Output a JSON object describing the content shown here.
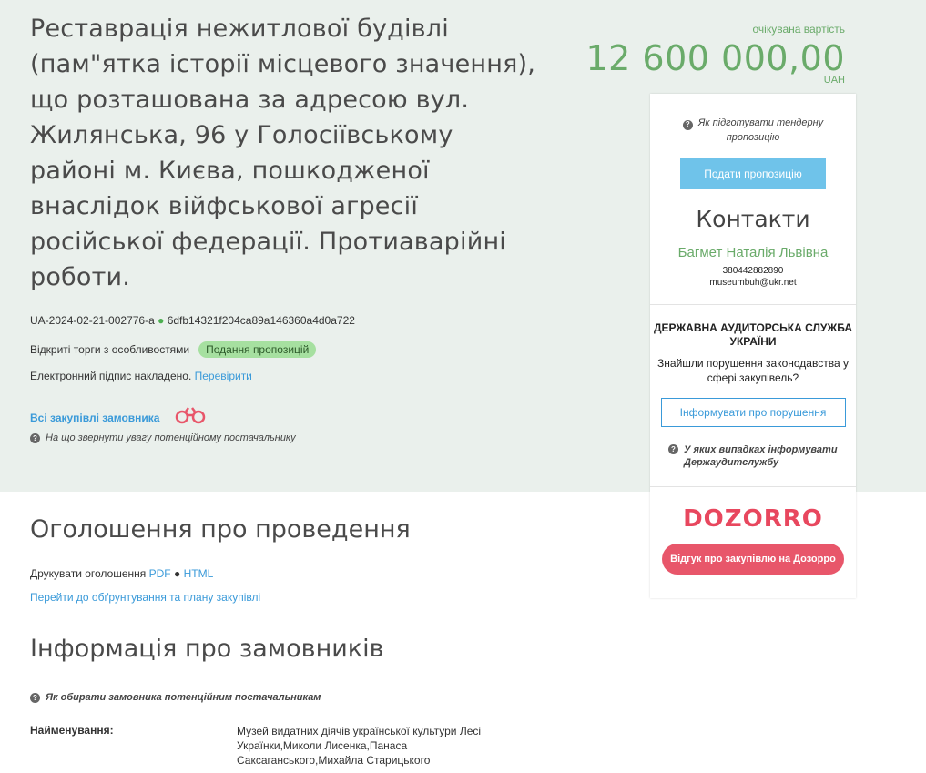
{
  "tender": {
    "title": "Реставрація нежитлової будівлі (пам\"ятка історії місцевого значення), що розташована за адресою вул. Жилянська, 96 у Голосіївському районі м. Києва, пошкодженої внаслідок війфськової агресії російської федерації. Протиаварійні роботи.",
    "id": "UA-2024-02-21-002776-a",
    "hash": "6dfb14321f204ca89a146360a4d0a722",
    "procedure_type": "Відкриті торги з особливостями",
    "status_badge": "Подання пропозицій",
    "signature_text": "Електронний підпис накладено.",
    "signature_link": "Перевірити",
    "all_purchases_link": "Всі закупівлі замовника",
    "supplier_attention": "На що звернути увагу потенційному постачальнику"
  },
  "price": {
    "label": "очікувана вартість",
    "amount": "12 600 000,00",
    "currency": "UAH"
  },
  "panel": {
    "how_to_prepare": "Як підготувати тендерну пропозицію",
    "submit_button": "Подати пропозицію",
    "contacts_title": "Контакти",
    "contact_name": "Багмет Наталія Львівна",
    "contact_phone": "380442882890",
    "contact_email": "museumbuh@ukr.net",
    "audit_title": "ДЕРЖАВНА АУДИТОРСЬКА СЛУЖБА УКРАЇНИ",
    "audit_question": "Знайшли порушення законодавства у сфері закупівель?",
    "report_button": "Інформувати про порушення",
    "audit_help": "У яких випадках інформувати Держаудитслужбу",
    "dozorro_logo": "DOZORRO",
    "dozorro_button": "Відгук про закупівлю на Дозорро"
  },
  "announcement": {
    "heading": "Оголошення про проведення",
    "print_label": "Друкувати оголошення",
    "pdf_link": "PDF",
    "html_link": "HTML",
    "plan_link": "Перейти до обґрунтування та плану закупівлі"
  },
  "customers": {
    "heading": "Інформація про замовників",
    "help": "Як обирати замовника потенційним постачальникам",
    "name_label": "Найменування:",
    "name_value": "Музей видатних діячів української культури Лесі Українки,Миколи Лисенка,Панаса Саксаганського,Михайла Старицького"
  },
  "icons": {
    "binoculars": "binoculars-icon",
    "question": "question-circle-icon"
  },
  "colors": {
    "accent_green": "#6aab6a",
    "link_blue": "#3a9ad9",
    "submit_blue": "#6fc3ea",
    "dozorro_red": "#e8475e",
    "hero_bg": "#eaf0ec"
  }
}
